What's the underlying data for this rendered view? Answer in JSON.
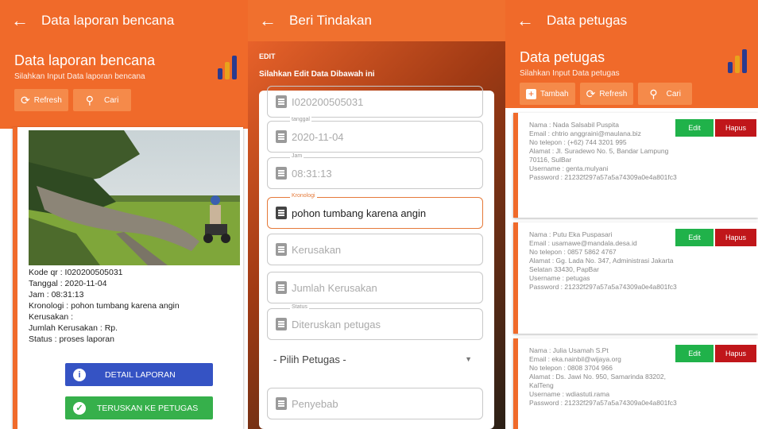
{
  "colors": {
    "primary": "#f06a2a",
    "blue": "#3553c4",
    "green": "#36b04b",
    "edit_green": "#20b24a",
    "delete_red": "#c0161a"
  },
  "panel1": {
    "appbar_title": "Data laporan bencana",
    "header_title": "Data laporan bencana",
    "header_subtitle": "Silahkan Input Data laporan bencana",
    "refresh_label": "Refresh",
    "search_label": "Cari",
    "report": {
      "kode_qr": "Kode qr : I020200505031",
      "tanggal": "Tanggal : 2020-11-04",
      "jam": "Jam : 08:31:13",
      "kronologi": "Kronologi : pohon tumbang karena angin",
      "kerusakan": "Kerusakan :",
      "jumlah": "Jumlah Kerusakan : Rp.",
      "status": "Status : proses laporan"
    },
    "detail_button": "DETAIL LAPORAN",
    "forward_button": "TERUSKAN KE PETUGAS"
  },
  "panel2": {
    "appbar_title": "Beri Tindakan",
    "edit_label": "EDIT",
    "edit_subtitle": "Silahkan Edit Data Dibawah ini",
    "fields": [
      {
        "label": "",
        "value": "I020200505031",
        "active": false
      },
      {
        "label": "tanggal",
        "value": "2020-11-04",
        "active": false
      },
      {
        "label": "Jam",
        "value": "08:31:13",
        "active": false
      },
      {
        "label": "Kronologi",
        "value": "pohon tumbang karena angin",
        "active": true
      },
      {
        "label": "",
        "value": "Kerusakan",
        "active": false
      },
      {
        "label": "",
        "value": "Jumlah Kerusakan",
        "active": false
      },
      {
        "label": "Status",
        "value": "Diteruskan petugas",
        "active": false
      }
    ],
    "select_value": "- Pilih Petugas -",
    "penyebab_placeholder": "Penyebab"
  },
  "panel3": {
    "appbar_title": "Data petugas",
    "header_title": "Data petugas",
    "header_subtitle": "Silahkan Input Data petugas",
    "add_label": "Tambah",
    "refresh_label": "Refresh",
    "search_label": "Cari",
    "edit_label": "Edit",
    "delete_label": "Hapus",
    "officers": [
      {
        "nama": "Nama : Nada Salsabil Puspita",
        "email": "Email : chtrio anggraini@maulana.biz",
        "telp": "No telepon : (+62) 744 3201 995",
        "alamat": "Alamat : Jl. Suradewo No. 5, Bandar Lampung 70116, SulBar",
        "username": "Username : genta.mulyani",
        "password": "Password : 21232f297a57a5a74309a0e4a801fc3"
      },
      {
        "nama": "Nama : Putu Eka Puspasari",
        "email": "Email : usamawe@mandala.desa.id",
        "telp": "No telepon : 0857 5862 4767",
        "alamat": "Alamat : Gg. Lada No. 347, Administrasi Jakarta Selatan 33430, PapBar",
        "username": "Username : petugas",
        "password": "Password : 21232f297a57a5a74309a0e4a801fc3"
      },
      {
        "nama": "Nama : Julia Usamah S.Pt",
        "email": "Email : eka.nainbil@wijaya.org",
        "telp": "No telepon : 0808 3704 966",
        "alamat": "Alamat : Ds. Jawi No. 950, Samarinda 83202, KalTeng",
        "username": "Username : wdiastuti.rama",
        "password": "Password : 21232f297a57a5a74309a0e4a801fc3"
      }
    ]
  }
}
